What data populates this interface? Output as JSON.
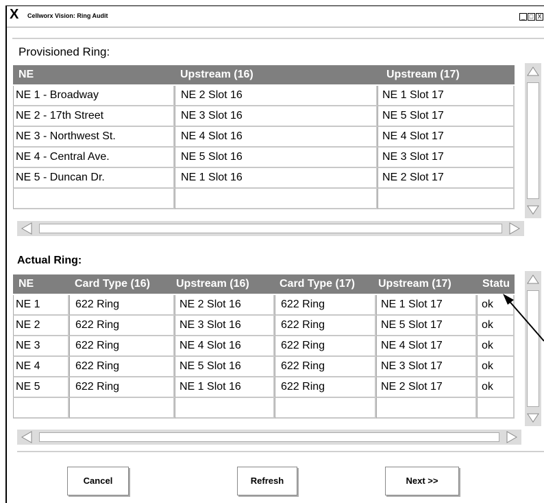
{
  "window": {
    "close_glyph": "X",
    "title": "Cellworx Vision: Ring Audit",
    "controls": [
      "_",
      "□",
      "X"
    ]
  },
  "provisioned": {
    "label": "Provisioned Ring:",
    "headers": [
      "NE",
      "Upstream (16)",
      "Upstream (17)"
    ],
    "rows": [
      [
        "NE 1 - Broadway",
        "NE 2 Slot 16",
        "NE 1 Slot 17"
      ],
      [
        "NE 2 - 17th Street",
        "NE 3 Slot 16",
        "NE 5  Slot 17"
      ],
      [
        "NE 3 - Northwest St.",
        "NE 4 Slot 16",
        "NE 4 Slot 17"
      ],
      [
        "NE 4 - Central Ave.",
        "NE 5 Slot 16",
        "NE 3 Slot 17"
      ],
      [
        "NE 5 - Duncan Dr.",
        "NE 1 Slot 16",
        "NE 2 Slot 17"
      ],
      [
        "",
        "",
        ""
      ]
    ]
  },
  "actual": {
    "label": "Actual Ring:",
    "headers": [
      "NE",
      "Card Type (16)",
      "Upstream (16)",
      "Card Type (17)",
      "Upstream (17)",
      "Statu"
    ],
    "rows": [
      [
        "NE 1",
        "622 Ring",
        "NE 2 Slot 16",
        "622 Ring",
        "NE 1 Slot 17",
        "ok"
      ],
      [
        "NE 2",
        "622 Ring",
        "NE 3 Slot 16",
        "622 Ring",
        "NE 5  Slot 17",
        "ok"
      ],
      [
        "NE 3",
        "622 Ring",
        "NE 4 Slot 16",
        "622 Ring",
        "NE 4 Slot 17",
        "ok"
      ],
      [
        "NE 4",
        "622 Ring",
        "NE 5 Slot 16",
        "622 Ring",
        "NE 3 Slot 17",
        "ok"
      ],
      [
        "NE 5",
        "622 Ring",
        "NE 1 Slot 16",
        "622 Ring",
        "NE 2 Slot 17",
        "ok"
      ],
      [
        "",
        "",
        "",
        "",
        "",
        ""
      ]
    ]
  },
  "buttons": {
    "cancel": "Cancel",
    "refresh": "Refresh",
    "next": "Next >>"
  }
}
